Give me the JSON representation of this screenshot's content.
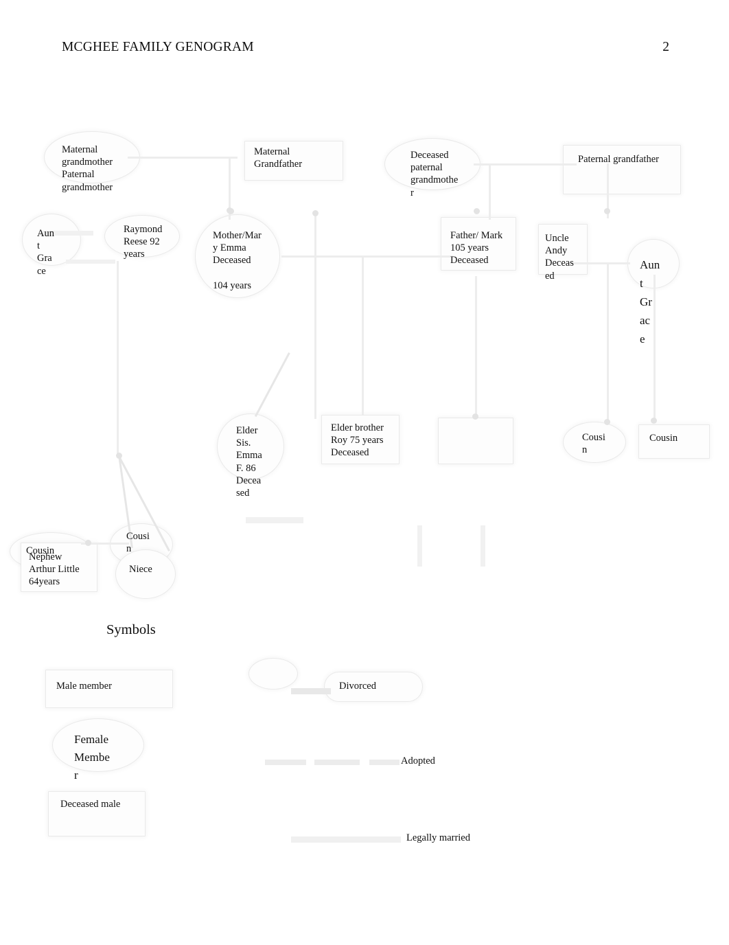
{
  "header": {
    "title": "MCGHEE FAMILY GENOGRAM",
    "page_number": "2"
  },
  "genogram": {
    "nodes": [
      {
        "id": "maternal-grandmother",
        "label": "Maternal\ngrandmother\n Paternal grandmother",
        "shape": "oval"
      },
      {
        "id": "maternal-grandfather",
        "label": "Maternal\nGrandfather",
        "shape": "box"
      },
      {
        "id": "deceased-paternal-grandmother",
        "label": "Deceased\npaternal\ngrandmothe\nr",
        "shape": "oval"
      },
      {
        "id": "paternal-grandfather",
        "label": "Paternal grandfather",
        "shape": "box"
      },
      {
        "id": "aunt-grace-left",
        "label": "Aun\nt\nGra\nce",
        "shape": "oval"
      },
      {
        "id": "raymond-reese",
        "label": "Raymond\nReese 92\nyears",
        "shape": "oval"
      },
      {
        "id": "mother-mary-emma",
        "label": "Mother/Mar\ny Emma\nDeceased\n\n104  years",
        "shape": "oval"
      },
      {
        "id": "father-mark",
        "label": "Father/ Mark\n105 years\nDeceased",
        "shape": "box"
      },
      {
        "id": "uncle-andy",
        "label": "Uncle\nAndy\nDeceas\ned",
        "shape": "box"
      },
      {
        "id": "aunt-grace-right",
        "label": "Aun\nt\nGr\nac\ne",
        "shape": "oval"
      },
      {
        "id": "elder-sister-emma",
        "label": "Elder\nSis.\nEmma\nF.   86\nDecea\nsed",
        "shape": "oval"
      },
      {
        "id": "elder-brother-roy",
        "label": "Elder brother\nRoy 75 years\nDeceased",
        "shape": "box"
      },
      {
        "id": "unlabeled-box",
        "label": "",
        "shape": "box"
      },
      {
        "id": "cousin-oval-right",
        "label": "Cousi\nn",
        "shape": "oval"
      },
      {
        "id": "cousin-box-right",
        "label": "Cousin",
        "shape": "box"
      },
      {
        "id": "cousin-bottom-left",
        "label": "Cousin",
        "shape": "oval"
      },
      {
        "id": "nephew-arthur-little",
        "label": "Nephew\nArthur Little\n64years",
        "shape": "box"
      },
      {
        "id": "cousin-bottom-middle",
        "label": "Cousi\nn",
        "shape": "oval"
      },
      {
        "id": "niece",
        "label": "Niece",
        "shape": "oval"
      }
    ]
  },
  "symbols": {
    "heading": "Symbols",
    "items": [
      {
        "id": "male-member",
        "label": "Male member",
        "shape": "box"
      },
      {
        "id": "female-member",
        "label": "Female\nMembe\nr",
        "shape": "oval"
      },
      {
        "id": "deceased-male",
        "label": "Deceased male",
        "shape": "box"
      },
      {
        "id": "divorced",
        "label": "Divorced",
        "shape": "rounded"
      },
      {
        "id": "adopted",
        "label": "Adopted",
        "shape": "dashed-line"
      },
      {
        "id": "legally-married",
        "label": "Legally married",
        "shape": "solid-line"
      }
    ]
  }
}
